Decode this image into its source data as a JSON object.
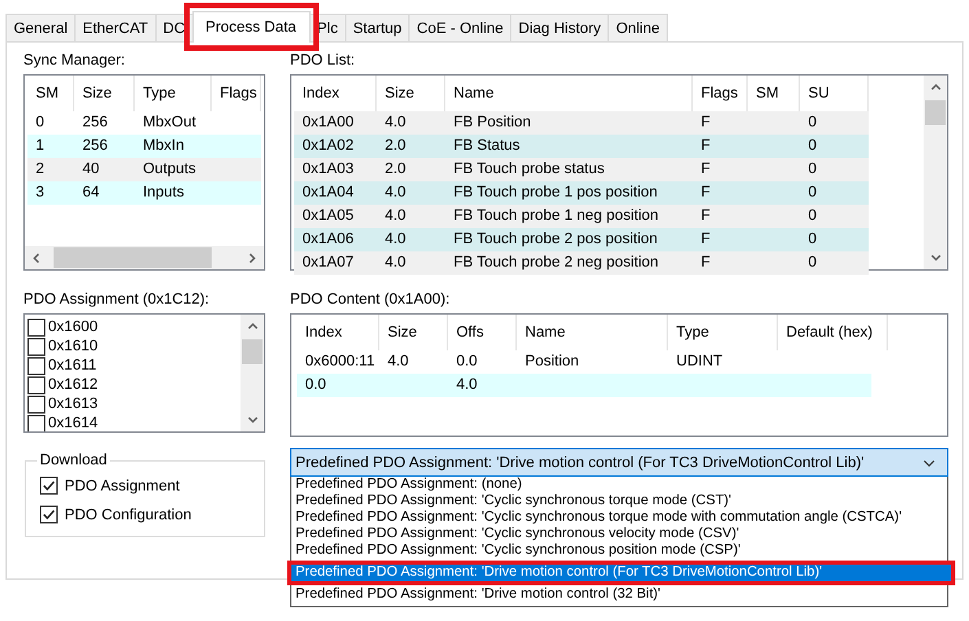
{
  "tabs": [
    {
      "label": "General",
      "selected": false,
      "highlighted": false
    },
    {
      "label": "EtherCAT",
      "selected": false,
      "highlighted": false
    },
    {
      "label": "DC",
      "selected": false,
      "highlighted": false
    },
    {
      "label": "Process Data",
      "selected": true,
      "highlighted": true
    },
    {
      "label": "Plc",
      "selected": false,
      "highlighted": false
    },
    {
      "label": "Startup",
      "selected": false,
      "highlighted": false
    },
    {
      "label": "CoE - Online",
      "selected": false,
      "highlighted": false
    },
    {
      "label": "Diag History",
      "selected": false,
      "highlighted": false
    },
    {
      "label": "Online",
      "selected": false,
      "highlighted": false
    }
  ],
  "sync_manager": {
    "label": "Sync Manager:",
    "columns": [
      "SM",
      "Size",
      "Type",
      "Flags"
    ],
    "rows": [
      {
        "cells": [
          "0",
          "256",
          "MbxOut",
          ""
        ],
        "color": "#ffffff"
      },
      {
        "cells": [
          "1",
          "256",
          "MbxIn",
          ""
        ],
        "color": "#e0ffff"
      },
      {
        "cells": [
          "2",
          "40",
          "Outputs",
          ""
        ],
        "color": "#f0f0f0"
      },
      {
        "cells": [
          "3",
          "64",
          "Inputs",
          ""
        ],
        "color": "#e0ffff"
      }
    ]
  },
  "pdo_list": {
    "label": "PDO List:",
    "columns": [
      "Index",
      "Size",
      "Name",
      "Flags",
      "SM",
      "SU"
    ],
    "rows": [
      {
        "cells": [
          "0x1A00",
          "4.0",
          "FB Position",
          "F",
          "",
          "0"
        ],
        "color": "#f0f0f0"
      },
      {
        "cells": [
          "0x1A02",
          "2.0",
          "FB Status",
          "F",
          "",
          "0"
        ],
        "color": "#d6eef0"
      },
      {
        "cells": [
          "0x1A03",
          "2.0",
          "FB Touch probe status",
          "F",
          "",
          "0"
        ],
        "color": "#f0f0f0"
      },
      {
        "cells": [
          "0x1A04",
          "4.0",
          "FB Touch probe 1 pos position",
          "F",
          "",
          "0"
        ],
        "color": "#d6eef0"
      },
      {
        "cells": [
          "0x1A05",
          "4.0",
          "FB Touch probe 1 neg position",
          "F",
          "",
          "0"
        ],
        "color": "#f0f0f0"
      },
      {
        "cells": [
          "0x1A06",
          "4.0",
          "FB Touch probe 2 pos position",
          "F",
          "",
          "0"
        ],
        "color": "#d6eef0"
      },
      {
        "cells": [
          "0x1A07",
          "4.0",
          "FB Touch probe 2 neg position",
          "F",
          "",
          "0"
        ],
        "color": "#f0f0f0"
      }
    ]
  },
  "pdo_assignment": {
    "label": "PDO Assignment (0x1C12):",
    "items": [
      {
        "label": "0x1600",
        "checked": false
      },
      {
        "label": "0x1610",
        "checked": false
      },
      {
        "label": "0x1611",
        "checked": false
      },
      {
        "label": "0x1612",
        "checked": false
      },
      {
        "label": "0x1613",
        "checked": false
      },
      {
        "label": "0x1614",
        "checked": false
      }
    ]
  },
  "pdo_content": {
    "label": "PDO Content (0x1A00):",
    "columns": [
      "Index",
      "Size",
      "Offs",
      "Name",
      "Type",
      "Default (hex)"
    ],
    "rows": [
      {
        "cells": [
          "0x6000:11",
          "4.0",
          "0.0",
          "Position",
          "UDINT",
          ""
        ],
        "color": "#ffffff"
      },
      {
        "cells": [
          "0.0",
          "",
          "4.0",
          "",
          "",
          ""
        ],
        "color": "#e0ffff"
      }
    ]
  },
  "download": {
    "label": "Download",
    "options": [
      {
        "label": "PDO Assignment",
        "checked": true
      },
      {
        "label": "PDO Configuration",
        "checked": true
      }
    ]
  },
  "predefined": {
    "value": "Predefined PDO Assignment: 'Drive motion control (For TC3 DriveMotionControl Lib)'",
    "options": [
      {
        "label": "Predefined PDO Assignment: (none)",
        "selected": false,
        "highlighted": false
      },
      {
        "label": "Predefined PDO Assignment: 'Cyclic synchronous torque mode (CST)'",
        "selected": false,
        "highlighted": false
      },
      {
        "label": "Predefined PDO Assignment: 'Cyclic synchronous torque mode with commutation angle (CSTCA)'",
        "selected": false,
        "highlighted": false
      },
      {
        "label": "Predefined PDO Assignment: 'Cyclic synchronous velocity mode (CSV)'",
        "selected": false,
        "highlighted": false
      },
      {
        "label": "Predefined PDO Assignment: 'Cyclic synchronous position mode (CSP)'",
        "selected": false,
        "highlighted": false
      },
      {
        "label": "Predefined PDO Assignment: 'Drive motion control (For TC3 DriveMotionControl Lib)'",
        "selected": true,
        "highlighted": true
      },
      {
        "label": "Predefined PDO Assignment: 'Drive motion control (32 Bit)'",
        "selected": false,
        "highlighted": false
      }
    ]
  }
}
